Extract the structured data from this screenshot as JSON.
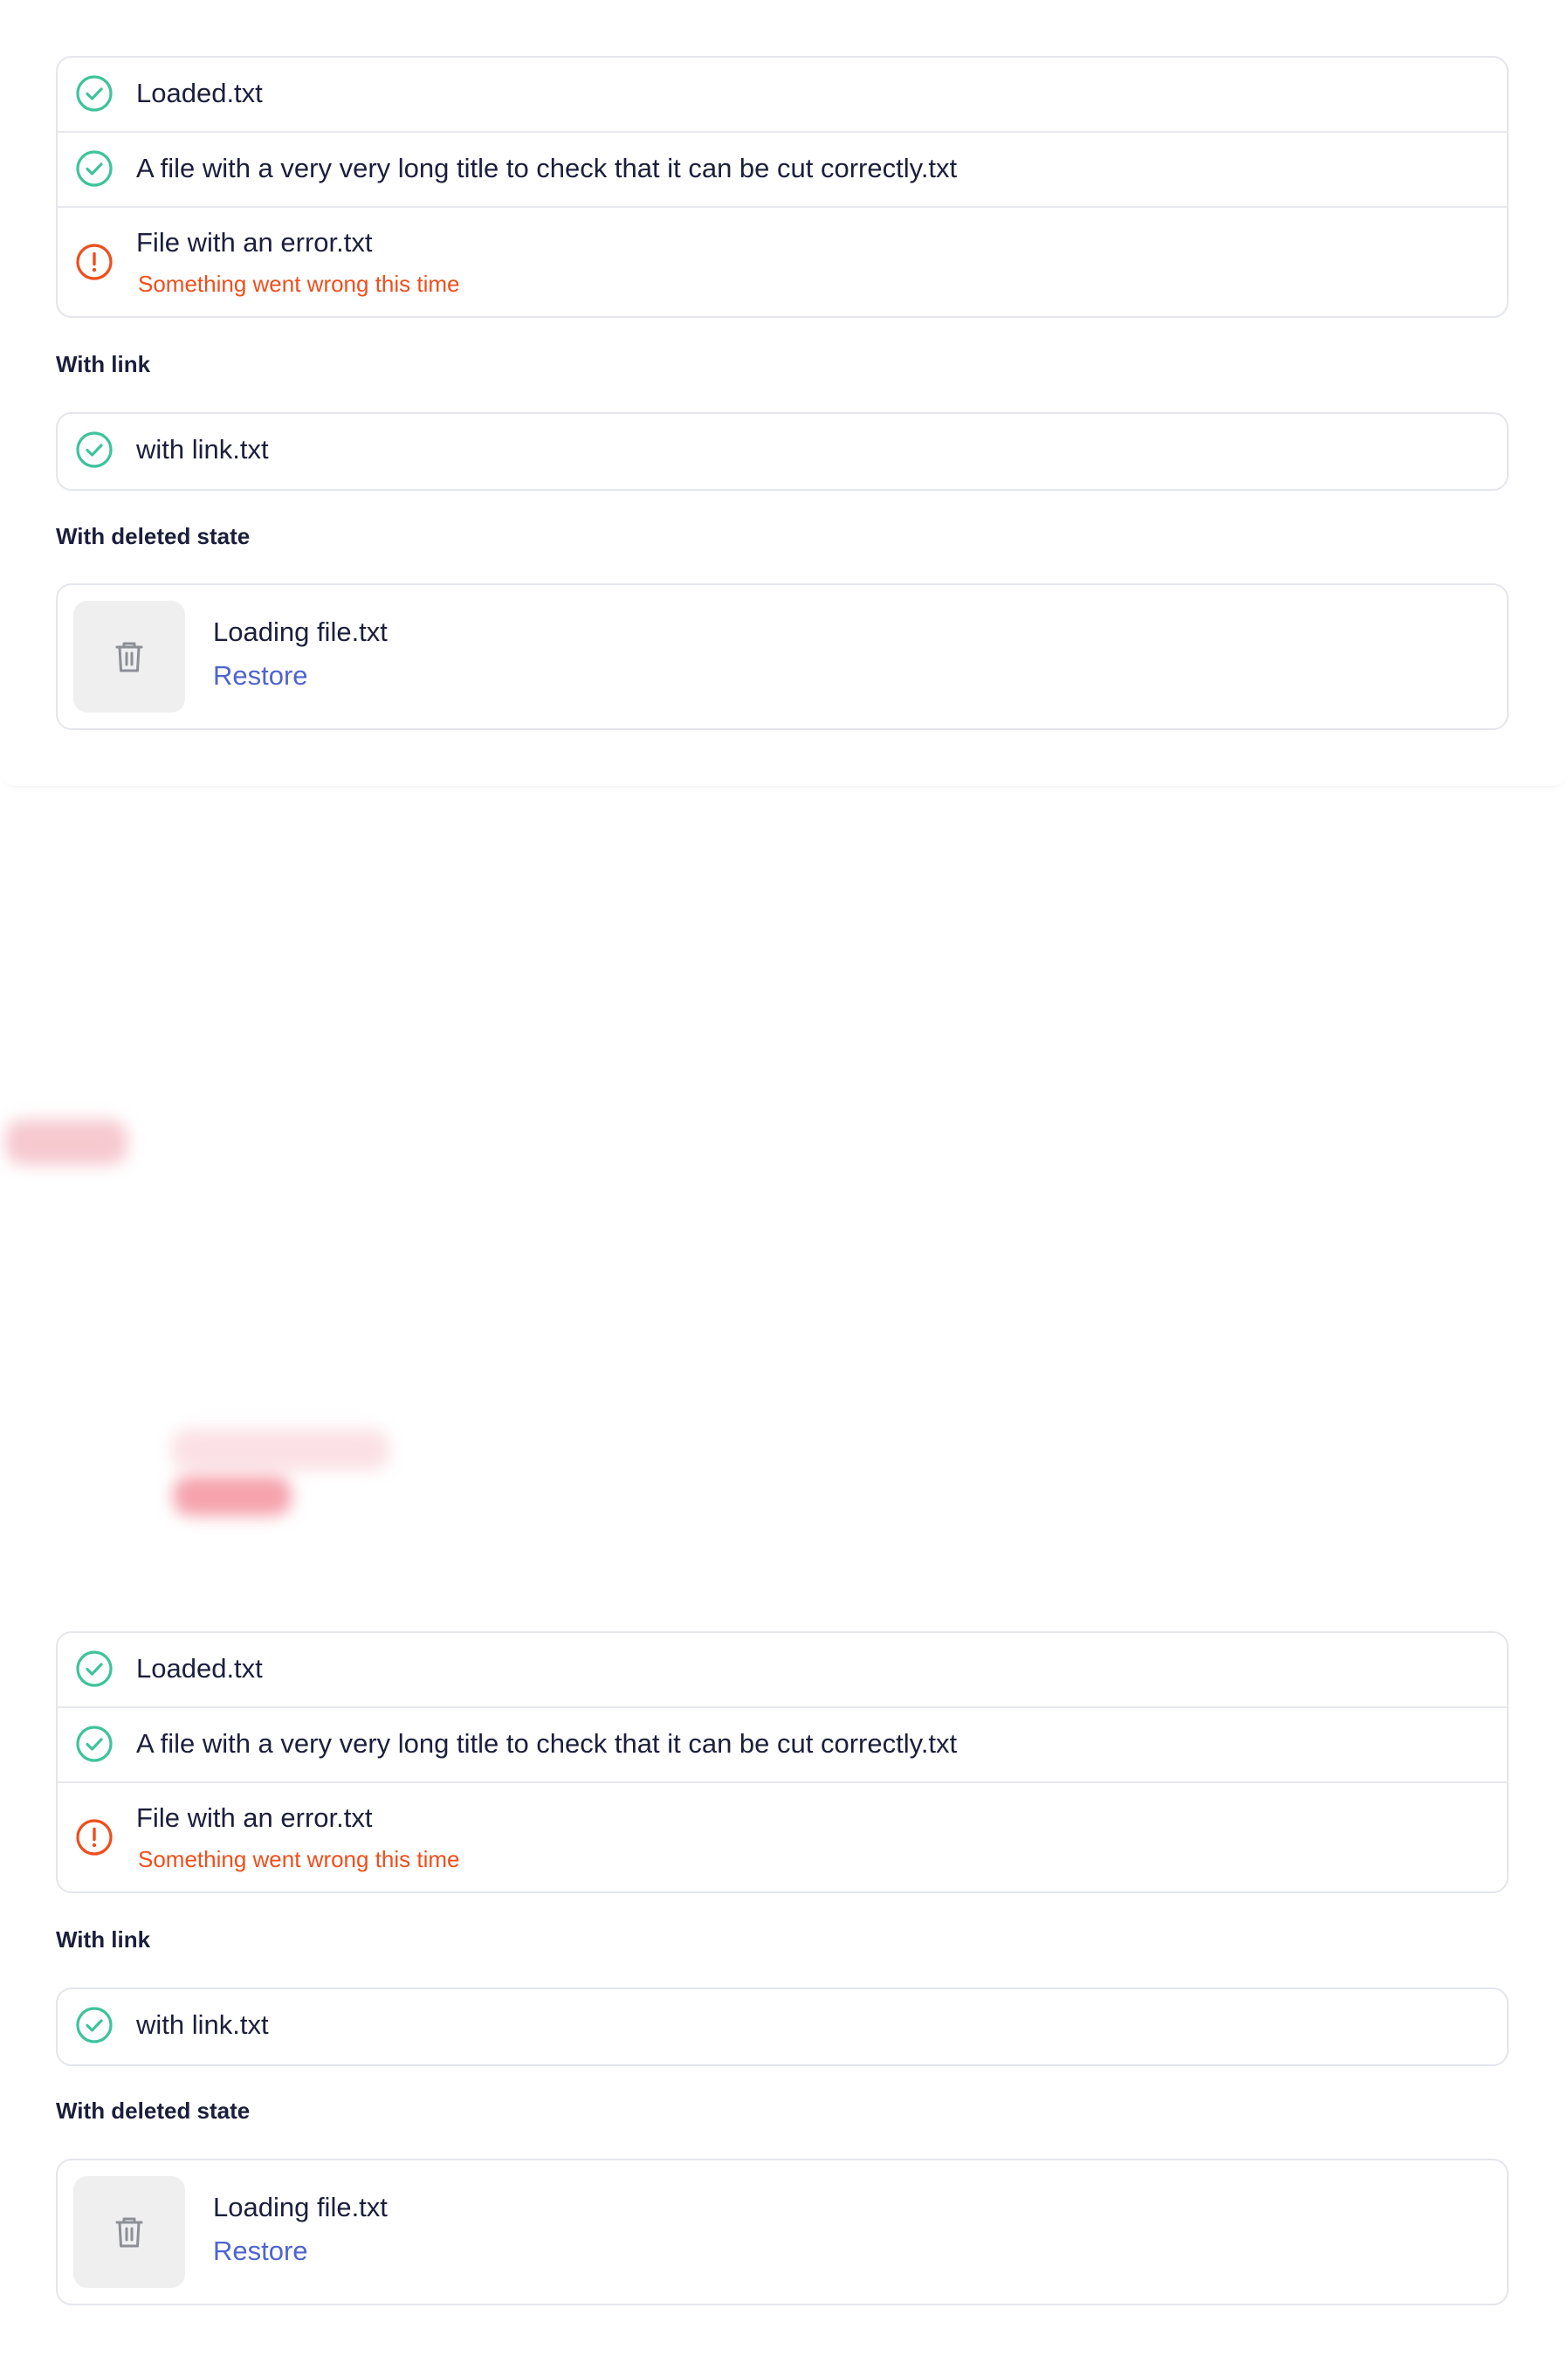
{
  "top": {
    "files": [
      {
        "name": "Loaded.txt",
        "status": "success"
      },
      {
        "name": "A file with a very very long title to check that it can be cut correctly.txt",
        "status": "success"
      },
      {
        "name": "File with an error.txt",
        "status": "error",
        "error": "Something went wrong this time"
      }
    ],
    "with_link_label": "With link",
    "link_file": {
      "name": "with link.txt",
      "status": "success"
    },
    "deleted_label": "With deleted state",
    "deleted_file": {
      "name": "Loading file.txt",
      "restore_label": "Restore"
    }
  },
  "bottom": {
    "files": [
      {
        "name": "Loaded.txt",
        "status": "success"
      },
      {
        "name": "A file with a very very long title to check that it can be cut correctly.txt",
        "status": "success"
      },
      {
        "name": "File with an error.txt",
        "status": "error",
        "error": "Something went wrong this time"
      }
    ],
    "with_link_label": "With link",
    "link_file": {
      "name": "with link.txt",
      "status": "success"
    },
    "deleted_label": "With deleted state",
    "deleted_file": {
      "name": "Loading file.txt",
      "restore_label": "Restore"
    }
  },
  "colors": {
    "success": "#3ec39b",
    "error": "#ef4e1c",
    "link": "#4f64cf",
    "text": "#1b1f3b",
    "border": "#e4e6ec"
  }
}
